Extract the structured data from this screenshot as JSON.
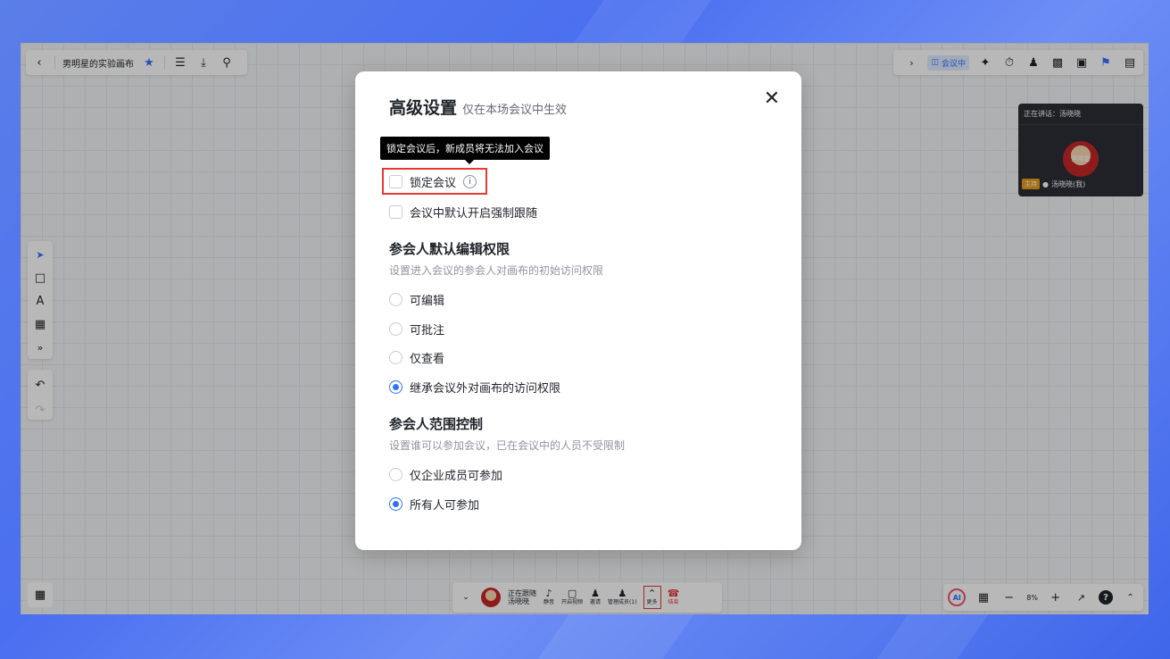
{
  "toolbar_left": {
    "board_title": "男明星的实验画布"
  },
  "toolbar_right": {
    "meeting_label": "会议中"
  },
  "speaker": {
    "speaking_label": "正在讲话：汤晓晓",
    "avatar_text": "男明星",
    "host_tag": "主持",
    "name": "汤晓晓(我)"
  },
  "bottom_bar": {
    "following_label": "正在跟随",
    "following_name": "汤晓晓",
    "mute": "静音",
    "video": "开启视频",
    "invite": "邀请",
    "manage": "管理成员(1)",
    "more": "更多",
    "end": "结束"
  },
  "zoom": {
    "ai": "AI",
    "percent": "8%"
  },
  "modal": {
    "title": "高级设置",
    "subtitle": "仅在本场会议中生效",
    "tooltip": "锁定会议后，新成员将无法加入会议",
    "lock_label": "锁定会议",
    "follow_label": "会议中默认开启强制跟随",
    "perm_title": "参会人默认编辑权限",
    "perm_desc": "设置进入会议的参会人对画布的初始访问权限",
    "perm_options": [
      "可编辑",
      "可批注",
      "仅查看",
      "继承会议外对画布的访问权限"
    ],
    "perm_selected": "继承会议外对画布的访问权限",
    "scope_title": "参会人范围控制",
    "scope_desc": "设置谁可以参加会议，已在会议中的人员不受限制",
    "scope_options": [
      "仅企业成员可参加",
      "所有人可参加"
    ],
    "scope_selected": "所有人可参加"
  },
  "colors": {
    "accent": "#3370ff",
    "highlight": "#e53935"
  }
}
